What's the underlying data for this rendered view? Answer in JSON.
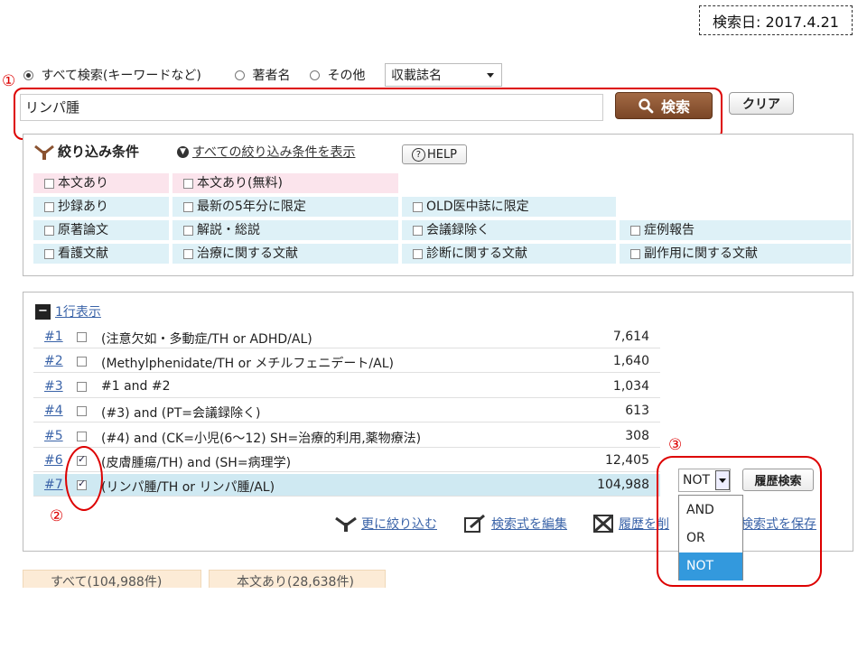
{
  "search_date": "検索日: 2017.4.21",
  "search_mode": {
    "options": [
      "すべて検索(キーワードなど)",
      "著者名",
      "その他"
    ],
    "selected_index": 0,
    "field_select": "収載誌名"
  },
  "search": {
    "query": "リンパ腫",
    "search_button": "検索",
    "clear_button": "クリア"
  },
  "annotations": {
    "n1": "①",
    "n2": "②",
    "n3": "③"
  },
  "filters": {
    "header": "絞り込み条件",
    "show_all": "すべての絞り込み条件を表示",
    "help": "HELP",
    "rows": [
      [
        "本文あり",
        "本文あり(無料)"
      ],
      [
        "抄録あり",
        "最新の5年分に限定",
        "OLD医中誌に限定"
      ],
      [
        "原著論文",
        "解説・総説",
        "会議録除く",
        "症例報告"
      ],
      [
        "看護文献",
        "治療に関する文献",
        "診断に関する文献",
        "副作用に関する文献"
      ]
    ]
  },
  "history": {
    "toggle": "1行表示",
    "rows": [
      {
        "num": "#1",
        "query": "(注意欠如・多動症/TH or ADHD/AL)",
        "count": "7,614",
        "checked": false
      },
      {
        "num": "#2",
        "query": "(Methylphenidate/TH or メチルフェニデート/AL)",
        "count": "1,640",
        "checked": false
      },
      {
        "num": "#3",
        "query": "#1 and #2",
        "count": "1,034",
        "checked": false
      },
      {
        "num": "#4",
        "query": "(#3) and (PT=会議録除く)",
        "count": "613",
        "checked": false
      },
      {
        "num": "#5",
        "query": "(#4) and (CK=小児(6〜12) SH=治療的利用,薬物療法)",
        "count": "308",
        "checked": false
      },
      {
        "num": "#6",
        "query": "(皮膚腫瘍/TH) and (SH=病理学)",
        "count": "12,405",
        "checked": true
      },
      {
        "num": "#7",
        "query": "(リンパ腫/TH or リンパ腫/AL)",
        "count": "104,988",
        "checked": true
      }
    ],
    "operator": "NOT",
    "history_search_button": "履歴検索",
    "operator_options": [
      "AND",
      "OR",
      "NOT"
    ],
    "actions": {
      "refine": "更に絞り込む",
      "edit": "検索式を編集",
      "delete": "履歴を削",
      "save": "検索式を保存"
    }
  },
  "tabs": [
    "すべて(104,988件)",
    "本文あり(28,638件)"
  ],
  "colors": {
    "accent_red": "#dd0000",
    "search_button": "#8a5230",
    "highlight": "#3399dd"
  }
}
